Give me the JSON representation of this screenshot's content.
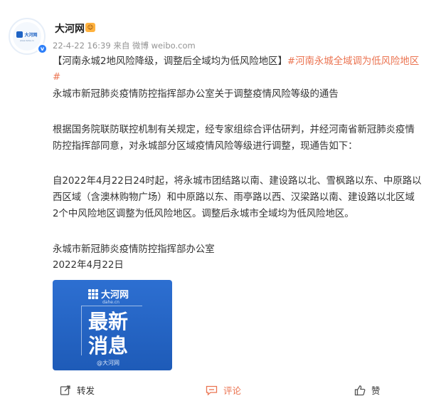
{
  "author": {
    "avatar_logo_text": "大河网",
    "avatar_sub_text": "www.dahe.cn",
    "name": "大河网",
    "badge_icon": "fan-badge-icon",
    "verified_icon": "verified-v-icon",
    "verified_mark": "v"
  },
  "meta": {
    "timestamp": "22-4-22 16:39",
    "source": "来自 微博 weibo.com"
  },
  "post": {
    "headline_bracketed": "【河南永城2地风险降级，调整后全域均为低风险地区】",
    "topic_part1": "#河南永城全域调为低风险地区",
    "topic_part2": "#",
    "notice_title": "永城市新冠肺炎疫情防控指挥部办公室关于调整疫情风险等级的通告",
    "para1_line1": "根据国务院联防联控机制有关规定，经专家组综合评估研判，并经河南省新冠肺炎疫情",
    "para1_line2": "防控指挥部同意，对永城部分区域疫情风险等级进行调整，现通告如下：",
    "para2_line1": "自2022年4月22日24时起，将永城市团结路以南、建设路以北、雪枫路以东、中原路以",
    "para2_line2": "西区域（含澳林购物广场）和中原路以东、雨亭路以西、汉梁路以南、建设路以北区域",
    "para2_line3": "2个中风险地区调整为低风险地区。调整后永城市全域均为低风险地区。",
    "signature": "永城市新冠肺炎疫情防控指挥部办公室",
    "date": "2022年4月22日"
  },
  "image": {
    "logo_text": "大河网",
    "logo_domain": "dahe.cn",
    "title_line1": "最新",
    "title_line2": "消息",
    "watermark": "@大河网"
  },
  "actions": {
    "share_label": "转发",
    "comment_label": "评论",
    "like_label": "赞",
    "share_icon": "share-icon",
    "comment_icon": "comment-icon",
    "like_icon": "thumbs-up-icon"
  },
  "colors": {
    "accent": "#eb7350",
    "image_bg": "#1e5bb8",
    "verified": "#2d7ff9"
  }
}
